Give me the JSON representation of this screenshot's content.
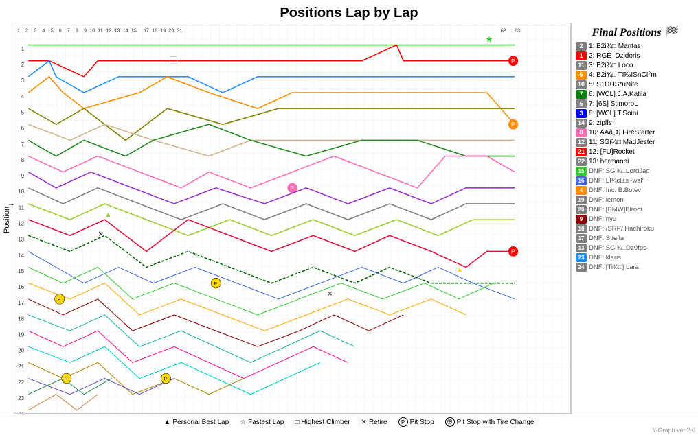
{
  "title": "Positions Lap by Lap",
  "yAxisLabel": "Position",
  "legend": {
    "title": "Final Positions",
    "items": [
      {
        "pos": 2,
        "color": "#808080",
        "text": "1: B2i¾□ Mantas"
      },
      {
        "pos": 1,
        "color": "#ff0000",
        "text": "2: RGÈ†Dzidoris"
      },
      {
        "pos": 11,
        "color": "#808080",
        "text": "3: B2i¾□ Loco"
      },
      {
        "pos": 5,
        "color": "#ff8c00",
        "text": "4: B2i¾□ TI‰ISnCI°m"
      },
      {
        "pos": 10,
        "color": "#808080",
        "text": "5: S1DUS*uNite"
      },
      {
        "pos": 7,
        "color": "#008000",
        "text": "6: [WCL] J.A.Katila"
      },
      {
        "pos": 6,
        "color": "#808080",
        "text": "7: [6S] StimoroL"
      },
      {
        "pos": 3,
        "color": "#0000ff",
        "text": "8: [WCL] T.Soini"
      },
      {
        "pos": 14,
        "color": "#808080",
        "text": "9: ziplfs"
      },
      {
        "pos": 8,
        "color": "#ff69b4",
        "text": "10: AAâ„¢| FireStarter"
      },
      {
        "pos": 12,
        "color": "#808080",
        "text": "11: SGi¾□ MadJester"
      },
      {
        "pos": 21,
        "color": "#ff0000",
        "text": "12: [FU]Rocket"
      },
      {
        "pos": 22,
        "color": "#808080",
        "text": "13: hermanni"
      }
    ],
    "dnf": [
      {
        "pos": 15,
        "color": "#32cd32",
        "text": "DNF: SGi¾□LordJag"
      },
      {
        "pos": 16,
        "color": "#4169e1",
        "text": "DNF: LÏ¼cI±s~wsIº"
      },
      {
        "pos": 4,
        "color": "#ff8c00",
        "text": "DNF: fnc. B.Botev"
      },
      {
        "pos": 19,
        "color": "#808080",
        "text": "DNF: lemon"
      },
      {
        "pos": 20,
        "color": "#808080",
        "text": "DNF: [BMW]Biroot"
      },
      {
        "pos": 9,
        "color": "#8b0000",
        "text": "DNF: nyu"
      },
      {
        "pos": 18,
        "color": "#808080",
        "text": "DNF: /SRP/ Hachiroku"
      },
      {
        "pos": 17,
        "color": "#808080",
        "text": "DNF: Stiefla"
      },
      {
        "pos": 13,
        "color": "#808080",
        "text": "DNF: SGi¾□Dz0fps"
      },
      {
        "pos": 23,
        "color": "#1e90ff",
        "text": "DNF: klaus"
      },
      {
        "pos": 24,
        "color": "#808080",
        "text": "DNF: [Ti¾□] Lara"
      }
    ]
  },
  "bottomLegend": [
    {
      "symbol": "▲",
      "text": "Personal Best Lap"
    },
    {
      "symbol": "☆",
      "text": "Fastest Lap"
    },
    {
      "symbol": "□",
      "text": "Highest Climber"
    },
    {
      "symbol": "✕",
      "text": "Retire"
    },
    {
      "symbol": "P",
      "text": "Pit Stop"
    },
    {
      "symbol": "Ⓟ",
      "text": "Pit Stop with Tire Change"
    }
  ],
  "watermark": "Y-Graph ver.2.0"
}
